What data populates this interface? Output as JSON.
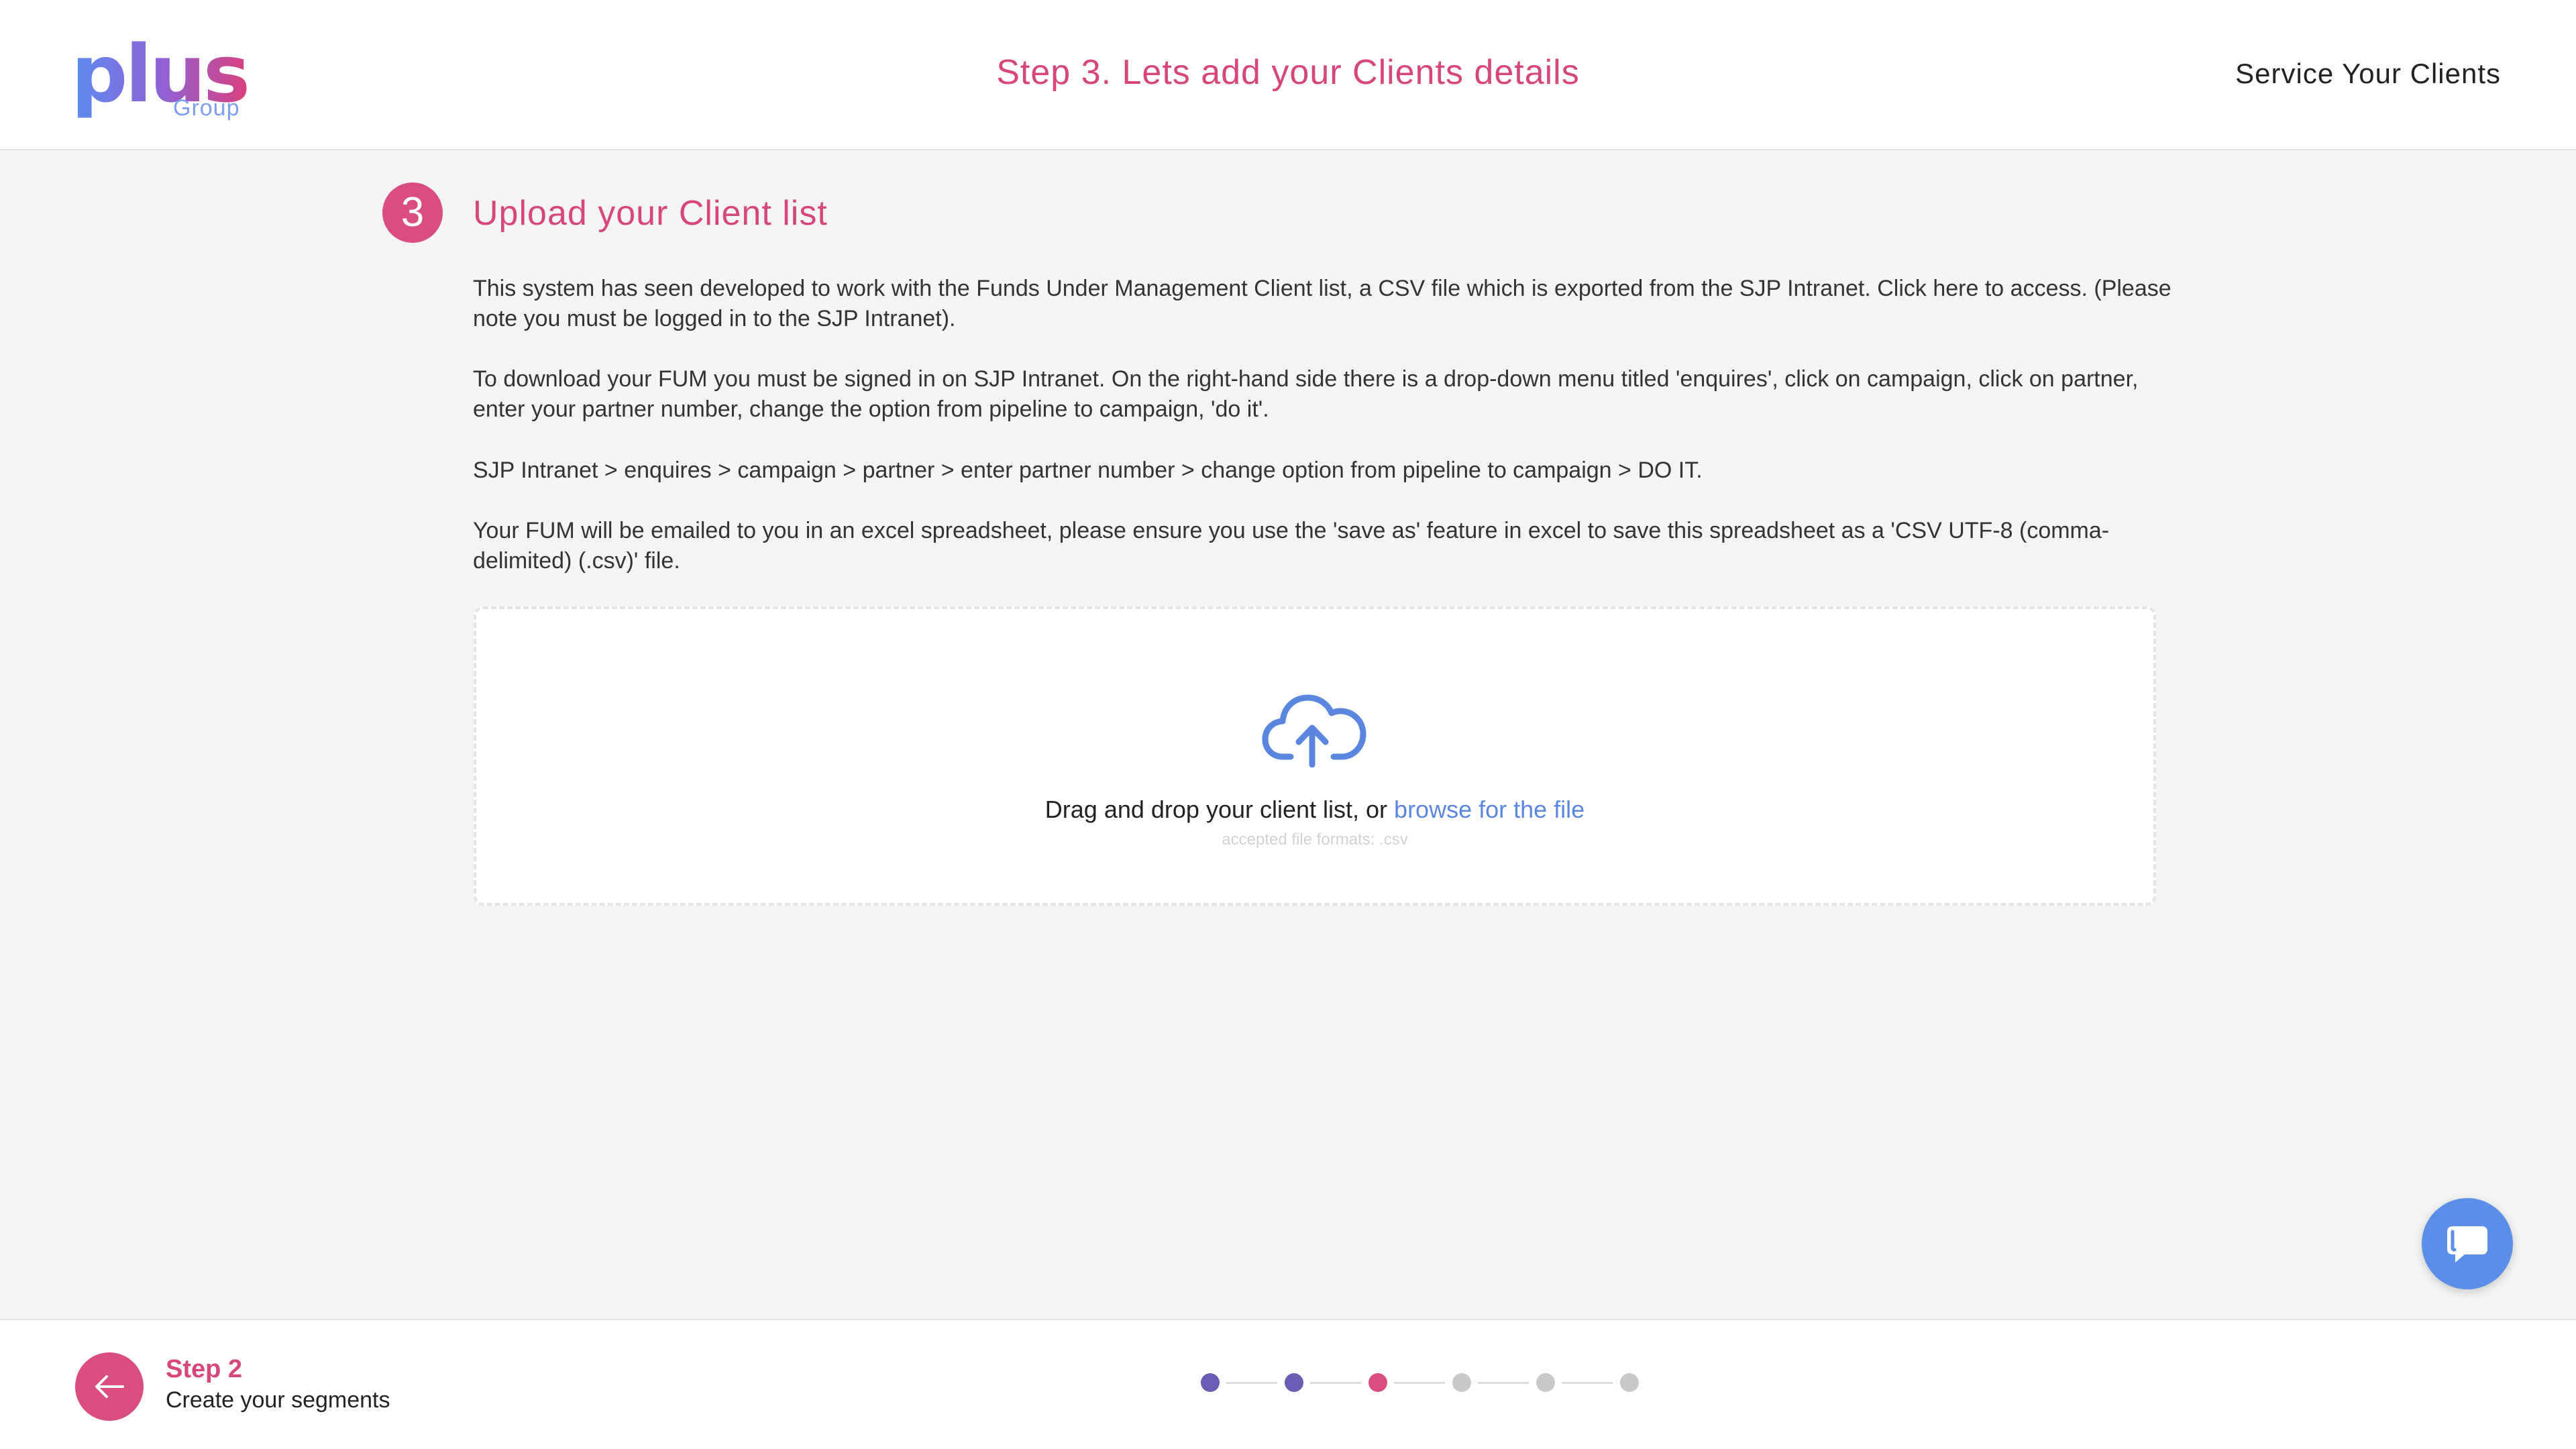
{
  "brand": {
    "logo_text": "plus",
    "logo_sub": "Group"
  },
  "header": {
    "title": "Step 3. Lets add your Clients details",
    "right_label": "Service Your Clients"
  },
  "section": {
    "step_number": "3",
    "title": "Upload your Client list",
    "paragraphs": [
      "This system has seen developed to work with the Funds Under Management Client list, a CSV file which is exported from the SJP Intranet. Click here to access. (Please note you must be logged in to the SJP Intranet).",
      "To download your FUM you must be signed in on SJP Intranet. On the right-hand side there is a drop-down menu titled 'enquires', click on campaign, click on partner, enter your partner number, change the option from pipeline to campaign, 'do it'.",
      "SJP Intranet > enquires > campaign > partner > enter partner number > change option from pipeline to campaign > DO IT.",
      "Your FUM will be emailed to you in an excel spreadsheet, please ensure you use the 'save as' feature in excel to save this spreadsheet as a 'CSV UTF-8 (comma-delimited) (.csv)' file."
    ]
  },
  "dropzone": {
    "icon": "cloud-upload-icon",
    "text": "Drag and drop your client list, or ",
    "link": "browse for the file",
    "formats": "accepted file formats: .csv"
  },
  "chat": {
    "icon": "chat-bubble-icon"
  },
  "footer": {
    "back_icon": "arrow-left-icon",
    "step_label": "Step 2",
    "step_name": "Create your segments"
  },
  "progress": {
    "total_steps": 6,
    "current_step": 3,
    "dot_colors": [
      "#6b5bb3",
      "#6b5bb3",
      "#d94d80",
      "#c8c8c8",
      "#c8c8c8",
      "#c8c8c8"
    ]
  },
  "colors": {
    "accent_pink": "#d6457c",
    "link_blue": "#5a86e0",
    "completed_purple": "#6b5bb3",
    "inactive_gray": "#c8c8c8",
    "chat_blue": "#5a8ee8"
  }
}
